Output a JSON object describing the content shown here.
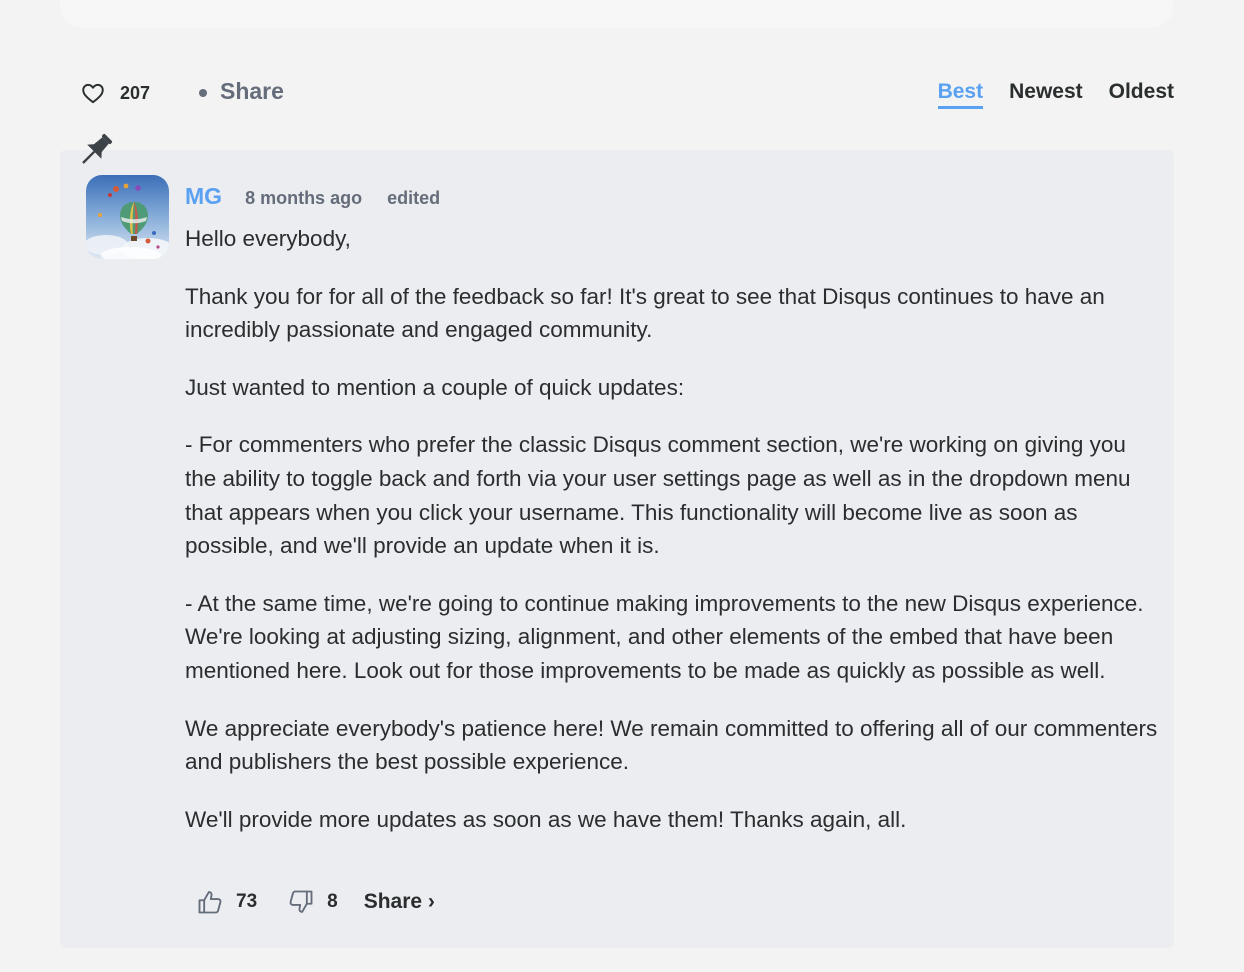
{
  "thread": {
    "like_count": "207",
    "share_label": "Share"
  },
  "sort_tabs": [
    {
      "label": "Best",
      "active": true
    },
    {
      "label": "Newest",
      "active": false
    },
    {
      "label": "Oldest",
      "active": false
    }
  ],
  "comment": {
    "pinned": true,
    "avatar_icon": "hot-air-balloon-avatar",
    "author": "MG",
    "timestamp": "8 months ago",
    "edited_label": "edited",
    "paragraphs": [
      "Hello everybody,",
      "Thank you for for all of the feedback so far! It's great to see that Disqus continues to have an incredibly passionate and engaged community.",
      "Just wanted to mention a couple of quick updates:",
      "- For commenters who prefer the classic Disqus comment section, we're working on giving you the ability to toggle back and forth via your user settings page as well as in the dropdown menu that appears when you click your username. This functionality will become live as soon as possible, and we'll provide an update when it is.",
      "- At the same time, we're going to continue making improvements to the new Disqus experience. We're looking at adjusting sizing, alignment, and other elements of the embed that have been mentioned here. Look out for those improvements to be made as quickly as possible as well.",
      "We appreciate everybody's patience here! We remain committed to offering all of our commenters and publishers the best possible experience.",
      "We'll provide more updates as soon as we have them! Thanks again, all."
    ],
    "upvotes": "73",
    "downvotes": "8",
    "share_label": "Share ›"
  },
  "colors": {
    "accent": "#5aa1f2",
    "text": "#2a2e2e",
    "muted": "#656c7a",
    "card": "#ebedf1",
    "page": "#f3f3f3"
  }
}
